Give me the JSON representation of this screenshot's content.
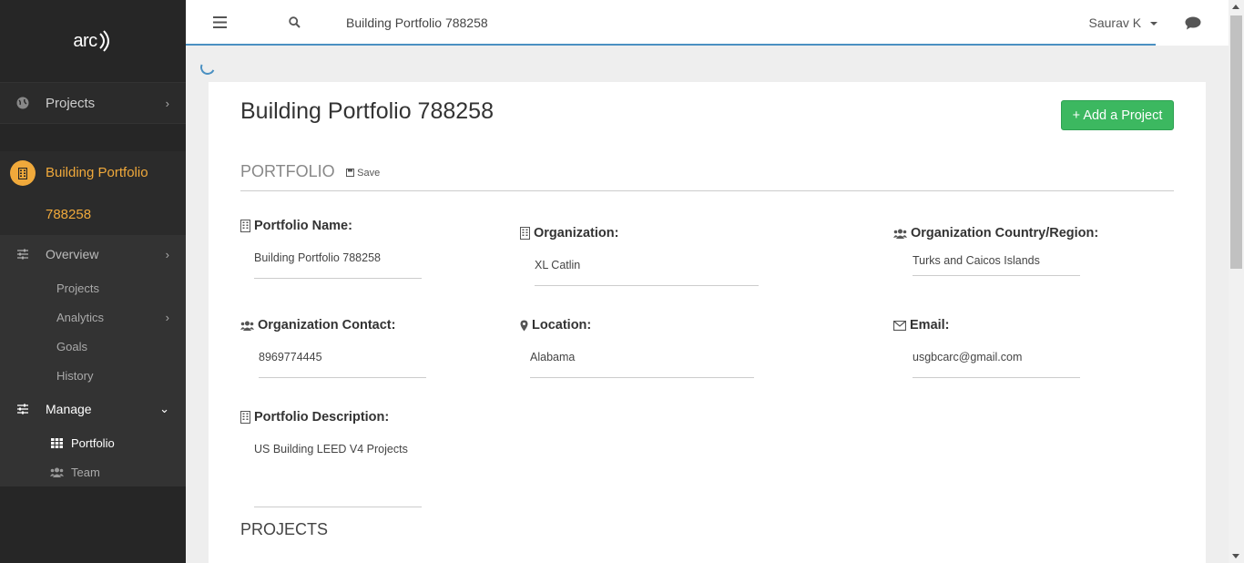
{
  "sidebar": {
    "logo_text": "arc",
    "projects_label": "Projects",
    "building_portfolio_line1": "Building Portfolio",
    "building_portfolio_line2": "788258",
    "overview_label": "Overview",
    "overview_items": [
      "Projects",
      "Analytics",
      "Goals",
      "History"
    ],
    "manage_label": "Manage",
    "manage_items": [
      "Portfolio",
      "Team"
    ],
    "accent_color": "#f0a93b"
  },
  "topbar": {
    "breadcrumb": "Building Portfolio 788258",
    "user_name": "Saurav K"
  },
  "main": {
    "page_title": "Building Portfolio 788258",
    "add_button_label": "+ Add a Project",
    "section_title": "PORTFOLIO",
    "save_label": "Save",
    "fields": {
      "portfolio_name": {
        "label": "Portfolio Name:",
        "value": "Building Portfolio 788258"
      },
      "organization": {
        "label": "Organization:",
        "value": "XL Catlin"
      },
      "org_country": {
        "label": "Organization Country/Region:",
        "value": "Turks and Caicos Islands"
      },
      "org_contact": {
        "label": "Organization Contact:",
        "value": "8969774445"
      },
      "location": {
        "label": "Location:",
        "value": "Alabama"
      },
      "email": {
        "label": "Email:",
        "value": "usgbcarc@gmail.com"
      },
      "description": {
        "label": "Portfolio Description:",
        "value": "US Building LEED V4 Projects"
      }
    },
    "projects_heading": "PROJECTS",
    "button_color": "#3cb860"
  }
}
